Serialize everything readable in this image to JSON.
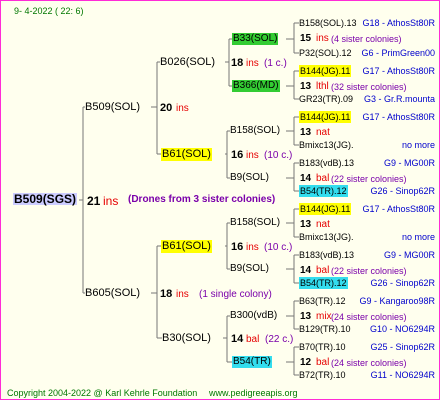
{
  "header": {
    "date": "9-   4-2022 (  22:   6)"
  },
  "footer": {
    "copyright": "Copyright 2004-2022 @ Karl Kehrle Foundation",
    "website": "www.pedigreeapis.org"
  },
  "colors": {
    "border": "#ff2bd6",
    "background": "#ffffee",
    "inbreeding": "#e60000",
    "note": "#7a00aa",
    "yellow": "#ffff00",
    "green": "#33cc33",
    "cyan": "#33ddee",
    "root": "#ccccff"
  },
  "root": {
    "label": "B509(SGS)",
    "number": "21",
    "unit": "ins",
    "note": "(Drones from 3 sister colonies)"
  },
  "gen1": [
    {
      "label": "B509(SOL)",
      "number": "20",
      "unit": "ins"
    },
    {
      "label": "B605(SOL)",
      "number": "18",
      "unit": "ins",
      "note": "(1 single colony)"
    }
  ],
  "gen2": [
    {
      "label": "B026(SOL)",
      "number": "18",
      "unit": "ins",
      "note": "(1 c.)"
    },
    {
      "label": "B61(SOL)",
      "number": "16",
      "unit": "ins",
      "note": "(10 c.)"
    },
    {
      "label": "B61(SOL)",
      "number": "16",
      "unit": "ins",
      "note": "(10 c.)"
    },
    {
      "label": "B30(SOL)",
      "number": "14",
      "unit": "bal",
      "note": "(22 c.)"
    }
  ],
  "gen3": [
    {
      "label": "B33(SOL)"
    },
    {
      "label": "B366(MD)"
    },
    {
      "label": "B158(SOL)"
    },
    {
      "label": "B9(SOL)"
    },
    {
      "label": "B158(SOL)"
    },
    {
      "label": "B9(SOL)"
    },
    {
      "label": "B300(vdB)"
    },
    {
      "label": "B54(TR)"
    }
  ],
  "gen4": [
    {
      "a": "B158(SOL).13",
      "b": "G18 - AthosSt80R"
    },
    {
      "a": "15",
      "b": "ins",
      "c": "(4 sister colonies)"
    },
    {
      "a": "P32(SOL).12",
      "b": "G6 - PrimGreen00"
    },
    {
      "a": "B144(JG).11",
      "b": "G17 - AthosSt80R"
    },
    {
      "a": "13",
      "b": "lthl",
      "c": "(32 sister colonies)"
    },
    {
      "a": "GR23(TR).09",
      "b": "G3 - Gr.R.mounta"
    },
    {
      "a": "B144(JG).11",
      "b": "G17 - AthosSt80R"
    },
    {
      "a": "13",
      "b": "nat"
    },
    {
      "a": "Bmixc13(JG).",
      "b": "no more"
    },
    {
      "a": "B183(vdB).13",
      "b": "G9 - MG00R"
    },
    {
      "a": "14",
      "b": "bal",
      "c": "(22 sister colonies)"
    },
    {
      "a": "B54(TR).12",
      "b": "G26 - Sinop62R"
    },
    {
      "a": "B144(JG).11",
      "b": "G17 - AthosSt80R"
    },
    {
      "a": "13",
      "b": "nat"
    },
    {
      "a": "Bmixc13(JG).",
      "b": "no more"
    },
    {
      "a": "B183(vdB).13",
      "b": "G9 - MG00R"
    },
    {
      "a": "14",
      "b": "bal",
      "c": "(22 sister colonies)"
    },
    {
      "a": "B54(TR).12",
      "b": "G26 - Sinop62R"
    },
    {
      "a": "B63(TR).12",
      "b": "G9 - Kangaroo98R"
    },
    {
      "a": "13",
      "b": "mix",
      "c": "(24 sister colonies)"
    },
    {
      "a": "B129(TR).10",
      "b": "G10 - NO6294R"
    },
    {
      "a": "B70(TR).10",
      "b": "G25 - Sinop62R"
    },
    {
      "a": "12",
      "b": "bal",
      "c": "(24 sister colonies)"
    },
    {
      "a": "B72(TR).10",
      "b": "G11 - NO6294R"
    }
  ]
}
